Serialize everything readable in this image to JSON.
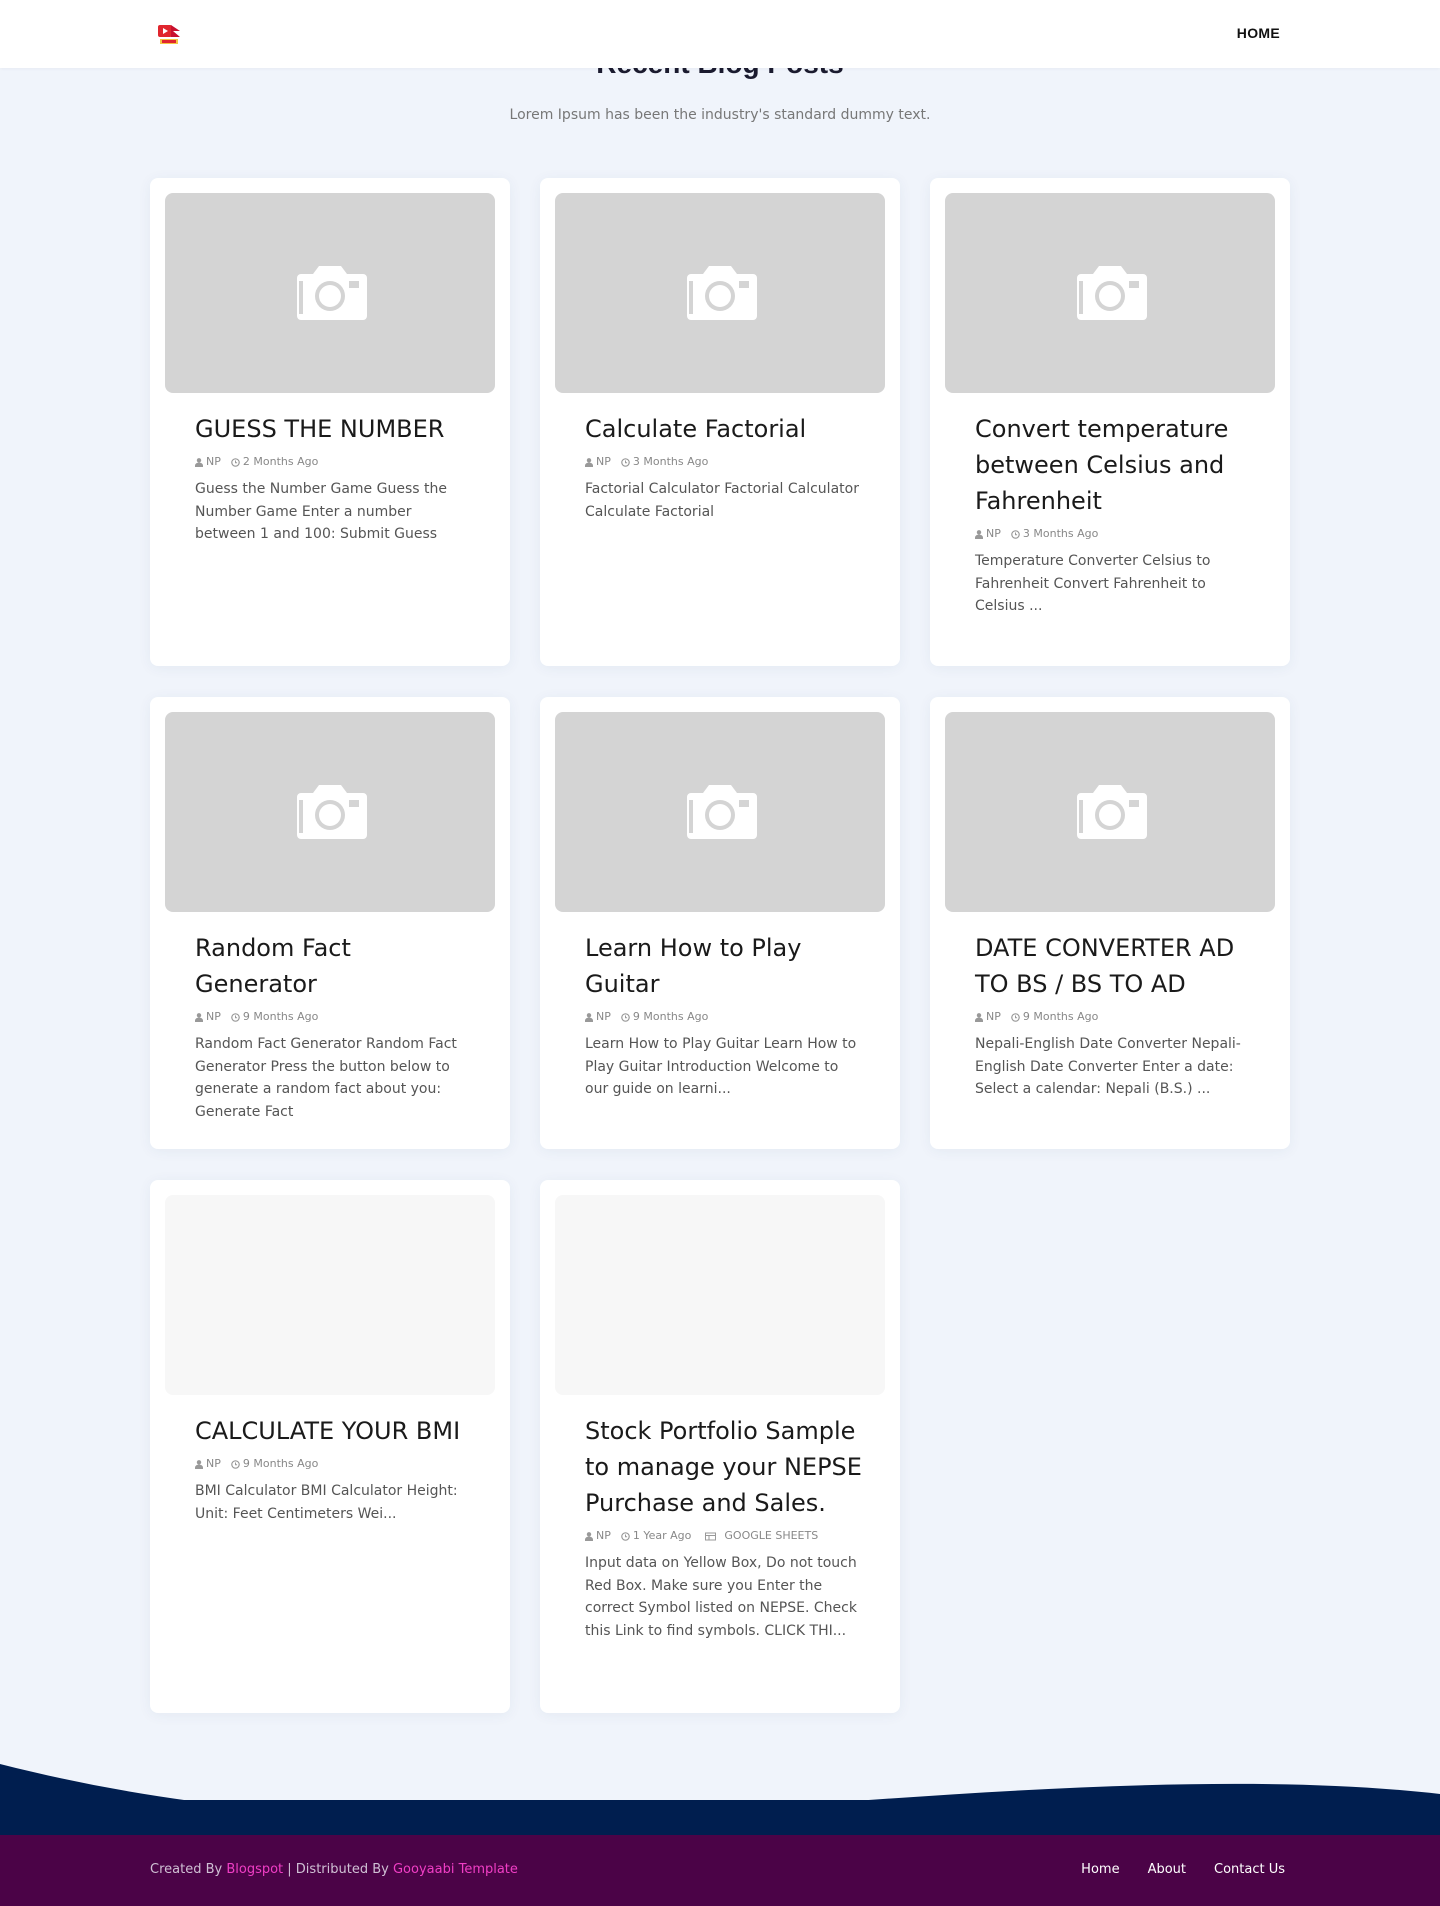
{
  "header": {
    "nav_home": "HOME"
  },
  "section": {
    "title": "Recent Blog Posts",
    "subtitle": "Lorem Ipsum has been the industry's standard dummy text."
  },
  "posts": [
    {
      "title": "GUESS THE NUMBER",
      "author": "NP",
      "date": "2 Months Ago",
      "label": "",
      "excerpt": "Guess the Number Game Guess the Number Game Enter a number between 1 and 100: Submit Guess",
      "thumb": "camera-placeholder"
    },
    {
      "title": "Calculate Factorial",
      "author": "NP",
      "date": "3 Months Ago",
      "label": "",
      "excerpt": "Factorial Calculator Factorial Calculator Calculate Factorial",
      "thumb": "camera-placeholder"
    },
    {
      "title": "Convert temperature between Celsius and Fahrenheit",
      "author": "NP",
      "date": "3 Months Ago",
      "label": "",
      "excerpt": "Temperature Converter Celsius to Fahrenheit Convert Fahrenheit to Celsius ...",
      "thumb": "camera-placeholder"
    },
    {
      "title": "Random Fact Generator",
      "author": "NP",
      "date": "9 Months Ago",
      "label": "",
      "excerpt": "Random Fact Generator Random Fact Generator Press the button below to generate a random fact about you: Generate Fact",
      "thumb": "camera-placeholder"
    },
    {
      "title": "Learn How to Play Guitar",
      "author": "NP",
      "date": "9 Months Ago",
      "label": "",
      "excerpt": "Learn How to Play Guitar Learn How to Play Guitar Introduction Welcome to our guide on learni...",
      "thumb": "camera-placeholder"
    },
    {
      "title": "DATE CONVERTER AD TO BS / BS TO AD",
      "author": "NP",
      "date": "9 Months Ago",
      "label": "",
      "excerpt": "Nepali-English Date Converter Nepali-English Date Converter Enter a date: Select a calendar: Nepali (B.S.) ...",
      "thumb": "camera-placeholder"
    },
    {
      "title": "CALCULATE YOUR BMI",
      "author": "NP",
      "date": "9 Months Ago",
      "label": "",
      "excerpt": "BMI Calculator BMI Calculator Height: Unit: Feet Centimeters Wei...",
      "thumb": "blank"
    },
    {
      "title": "Stock Portfolio Sample to manage your NEPSE Purchase and Sales.",
      "author": "NP",
      "date": "1 Year Ago",
      "label": "GOOGLE SHEETS",
      "excerpt": "Input data on Yellow Box, Do not touch Red Box. Make sure you Enter the correct Symbol listed on NEPSE. Check this  Link  to find symbols. CLICK THI...",
      "thumb": "blank"
    }
  ],
  "footer": {
    "created_by": "Created By",
    "blogspot": "Blogspot",
    "distributed_by": " | Distributed By",
    "template": "Gooyaabi Template",
    "links": [
      "Home",
      "About",
      "Contact Us"
    ]
  },
  "colors": {
    "page_bg": "#f0f4fb",
    "footer_navy": "#001e4f",
    "footer_purple": "#4b0347",
    "link_pink": "#f03ec5"
  }
}
